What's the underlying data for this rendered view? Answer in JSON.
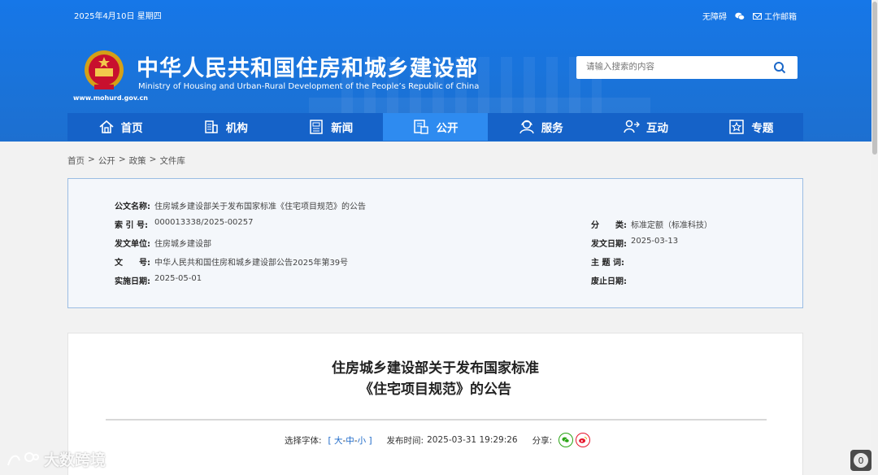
{
  "header": {
    "date": "2025年4月10日 星期四",
    "links": {
      "accessibility": "无障碍",
      "mail": "工作邮箱"
    },
    "title_cn": "中华人民共和国住房和城乡建设部",
    "title_en": "Ministry of Housing and Urban-Rural Development of the People’s Republic of China",
    "domain": "www.mohurd.gov.cn",
    "search_placeholder": "请输入搜索的内容"
  },
  "nav": [
    {
      "label": "首页",
      "icon": "home-icon"
    },
    {
      "label": "机构",
      "icon": "building-icon"
    },
    {
      "label": "新闻",
      "icon": "news-icon"
    },
    {
      "label": "公开",
      "icon": "document-icon",
      "active": true
    },
    {
      "label": "服务",
      "icon": "service-icon"
    },
    {
      "label": "互动",
      "icon": "interaction-icon"
    },
    {
      "label": "专题",
      "icon": "star-icon"
    }
  ],
  "breadcrumb": [
    "首页",
    "公开",
    "政策",
    "文件库"
  ],
  "info": {
    "name_k": "公文名称:",
    "name_v": "住房城乡建设部关于发布国家标准《住宅项目规范》的公告",
    "index_k": "索 引 号:",
    "index_v": "000013338/2025-00257",
    "category_k": "分　　类:",
    "category_v": "标准定额（标准科技）",
    "issuer_k": "发文单位:",
    "issuer_v": "住房城乡建设部",
    "issue_date_k": "发文日期:",
    "issue_date_v": "2025-03-13",
    "docno_k": "文　　号:",
    "docno_v": "中华人民共和国住房和城乡建设部公告2025年第39号",
    "subject_k": "主 题 词:",
    "subject_v": "",
    "effective_k": "实施日期:",
    "effective_v": "2025-05-01",
    "repeal_k": "废止日期:",
    "repeal_v": ""
  },
  "article": {
    "title_line1": "住房城乡建设部关于发布国家标准",
    "title_line2": "《住宅项目规范》的公告",
    "font_label": "选择字体:",
    "font_open": "[",
    "font_large": "大",
    "font_mid": "中",
    "font_small": "小",
    "font_close": "]",
    "publish_label": "发布时间:",
    "publish_time": "2025-03-31 19:29:26",
    "share_label": "分享:"
  },
  "watermark": "大数跨境",
  "badge_count": "0",
  "colors": {
    "header_blue": "#1677e8",
    "nav_blue": "#1562c8",
    "nav_active": "#2e8bf0"
  }
}
